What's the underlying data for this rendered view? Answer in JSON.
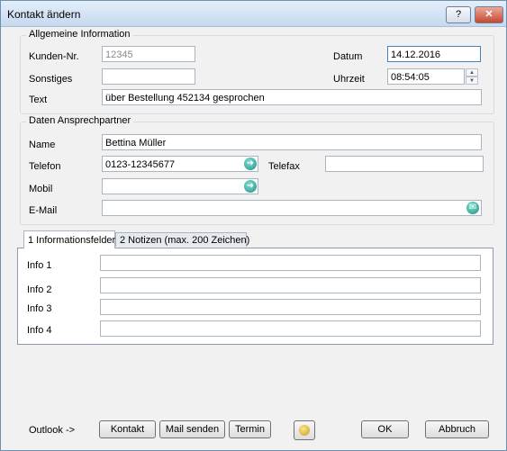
{
  "window": {
    "title": "Kontakt ändern",
    "help_label": "?",
    "minimize_label": "▬",
    "close_label": "✕"
  },
  "general": {
    "title": "Allgemeine Information",
    "kunden_label": "Kunden-Nr.",
    "kunden_value": "12345",
    "sonstiges_label": "Sonstiges",
    "sonstiges_value": "",
    "datum_label": "Datum",
    "datum_value": "14.12.2016",
    "uhrzeit_label": "Uhrzeit",
    "uhrzeit_value": "08:54:05",
    "text_label": "Text",
    "text_value": "über Bestellung 452134 gesprochen"
  },
  "contact": {
    "title": "Daten Ansprechpartner",
    "name_label": "Name",
    "name_value": "Bettina Müller",
    "telefon_label": "Telefon",
    "telefon_value": "0123-12345677",
    "telefax_label": "Telefax",
    "telefax_value": "",
    "mobil_label": "Mobil",
    "mobil_value": "",
    "email_label": "E-Mail",
    "email_value": ""
  },
  "tabs": [
    {
      "label": "1 Informationsfelder"
    },
    {
      "label": "2 Notizen (max. 200 Zeichen)"
    }
  ],
  "info_fields": [
    {
      "label": "Info 1",
      "value": ""
    },
    {
      "label": "Info 2",
      "value": ""
    },
    {
      "label": "Info 3",
      "value": ""
    },
    {
      "label": "Info 4",
      "value": ""
    }
  ],
  "footer": {
    "outlook_label": "Outlook ->",
    "kontakt_button": "Kontakt",
    "mail_button": "Mail senden",
    "termin_button": "Termin",
    "ok_button": "OK",
    "abbruch_button": "Abbruch"
  },
  "icons": {
    "phone": "phone-icon",
    "mail": "mail-icon",
    "outlook": "outlook-icon"
  },
  "colors": {
    "title_bar": "#c6d9ef",
    "close_button": "#c8472e",
    "action_icon": "#1f8f86"
  }
}
